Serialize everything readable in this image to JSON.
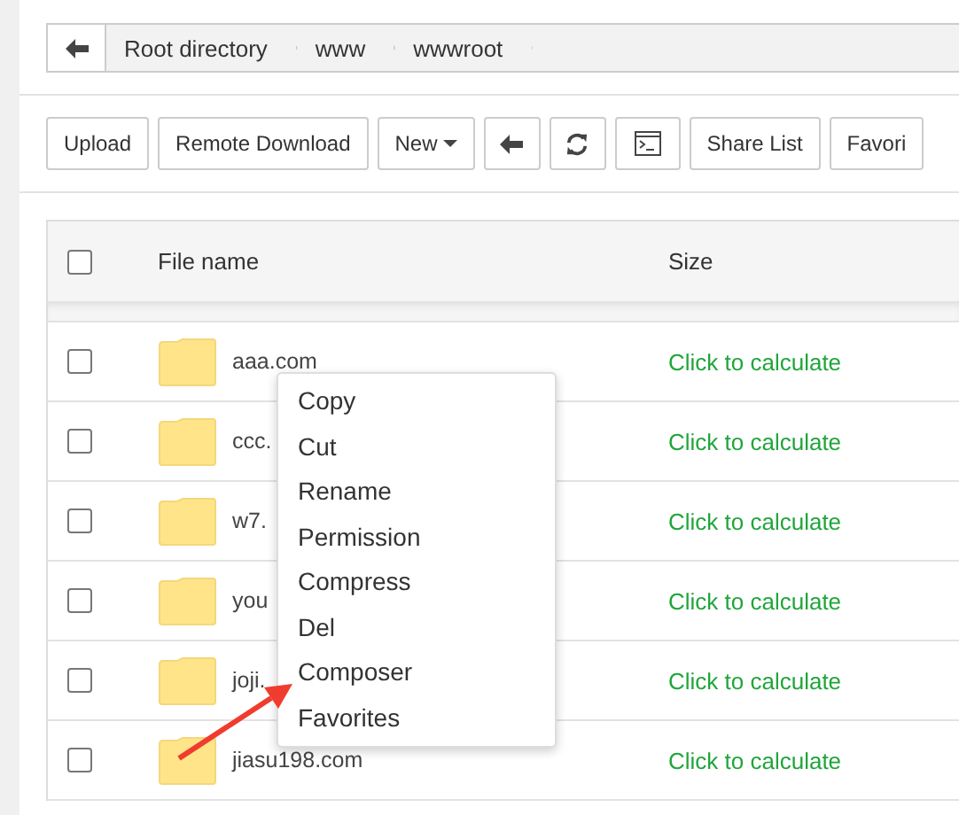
{
  "breadcrumb": {
    "segments": [
      "Root directory",
      "www",
      "wwwroot"
    ]
  },
  "toolbar": [
    {
      "kind": "text",
      "label": "Upload"
    },
    {
      "kind": "text",
      "label": "Remote Download"
    },
    {
      "kind": "dropdown",
      "label": "New"
    },
    {
      "kind": "back"
    },
    {
      "kind": "refresh"
    },
    {
      "kind": "terminal"
    },
    {
      "kind": "text",
      "label": "Share List"
    },
    {
      "kind": "text",
      "label": "Favori"
    }
  ],
  "table": {
    "select_all": {
      "checked": false
    },
    "columns": [
      "File name",
      "Size"
    ],
    "rows": [
      {
        "checked": false,
        "name": "aaa.com",
        "size": "Click to calculate"
      },
      {
        "checked": false,
        "name": "ccc.",
        "size": "Click to calculate"
      },
      {
        "checked": false,
        "name": "w7.",
        "size": "Click to calculate"
      },
      {
        "checked": false,
        "name": "you",
        "size": "Click to calculate"
      },
      {
        "checked": false,
        "name": "joji.",
        "size": "Click to calculate"
      },
      {
        "checked": false,
        "name": "jiasu198.com",
        "size": "Click to calculate"
      }
    ]
  },
  "context_menu": [
    "Copy",
    "Cut",
    "Rename",
    "Permission",
    "Compress",
    "Del",
    "Composer",
    "Favorites"
  ]
}
